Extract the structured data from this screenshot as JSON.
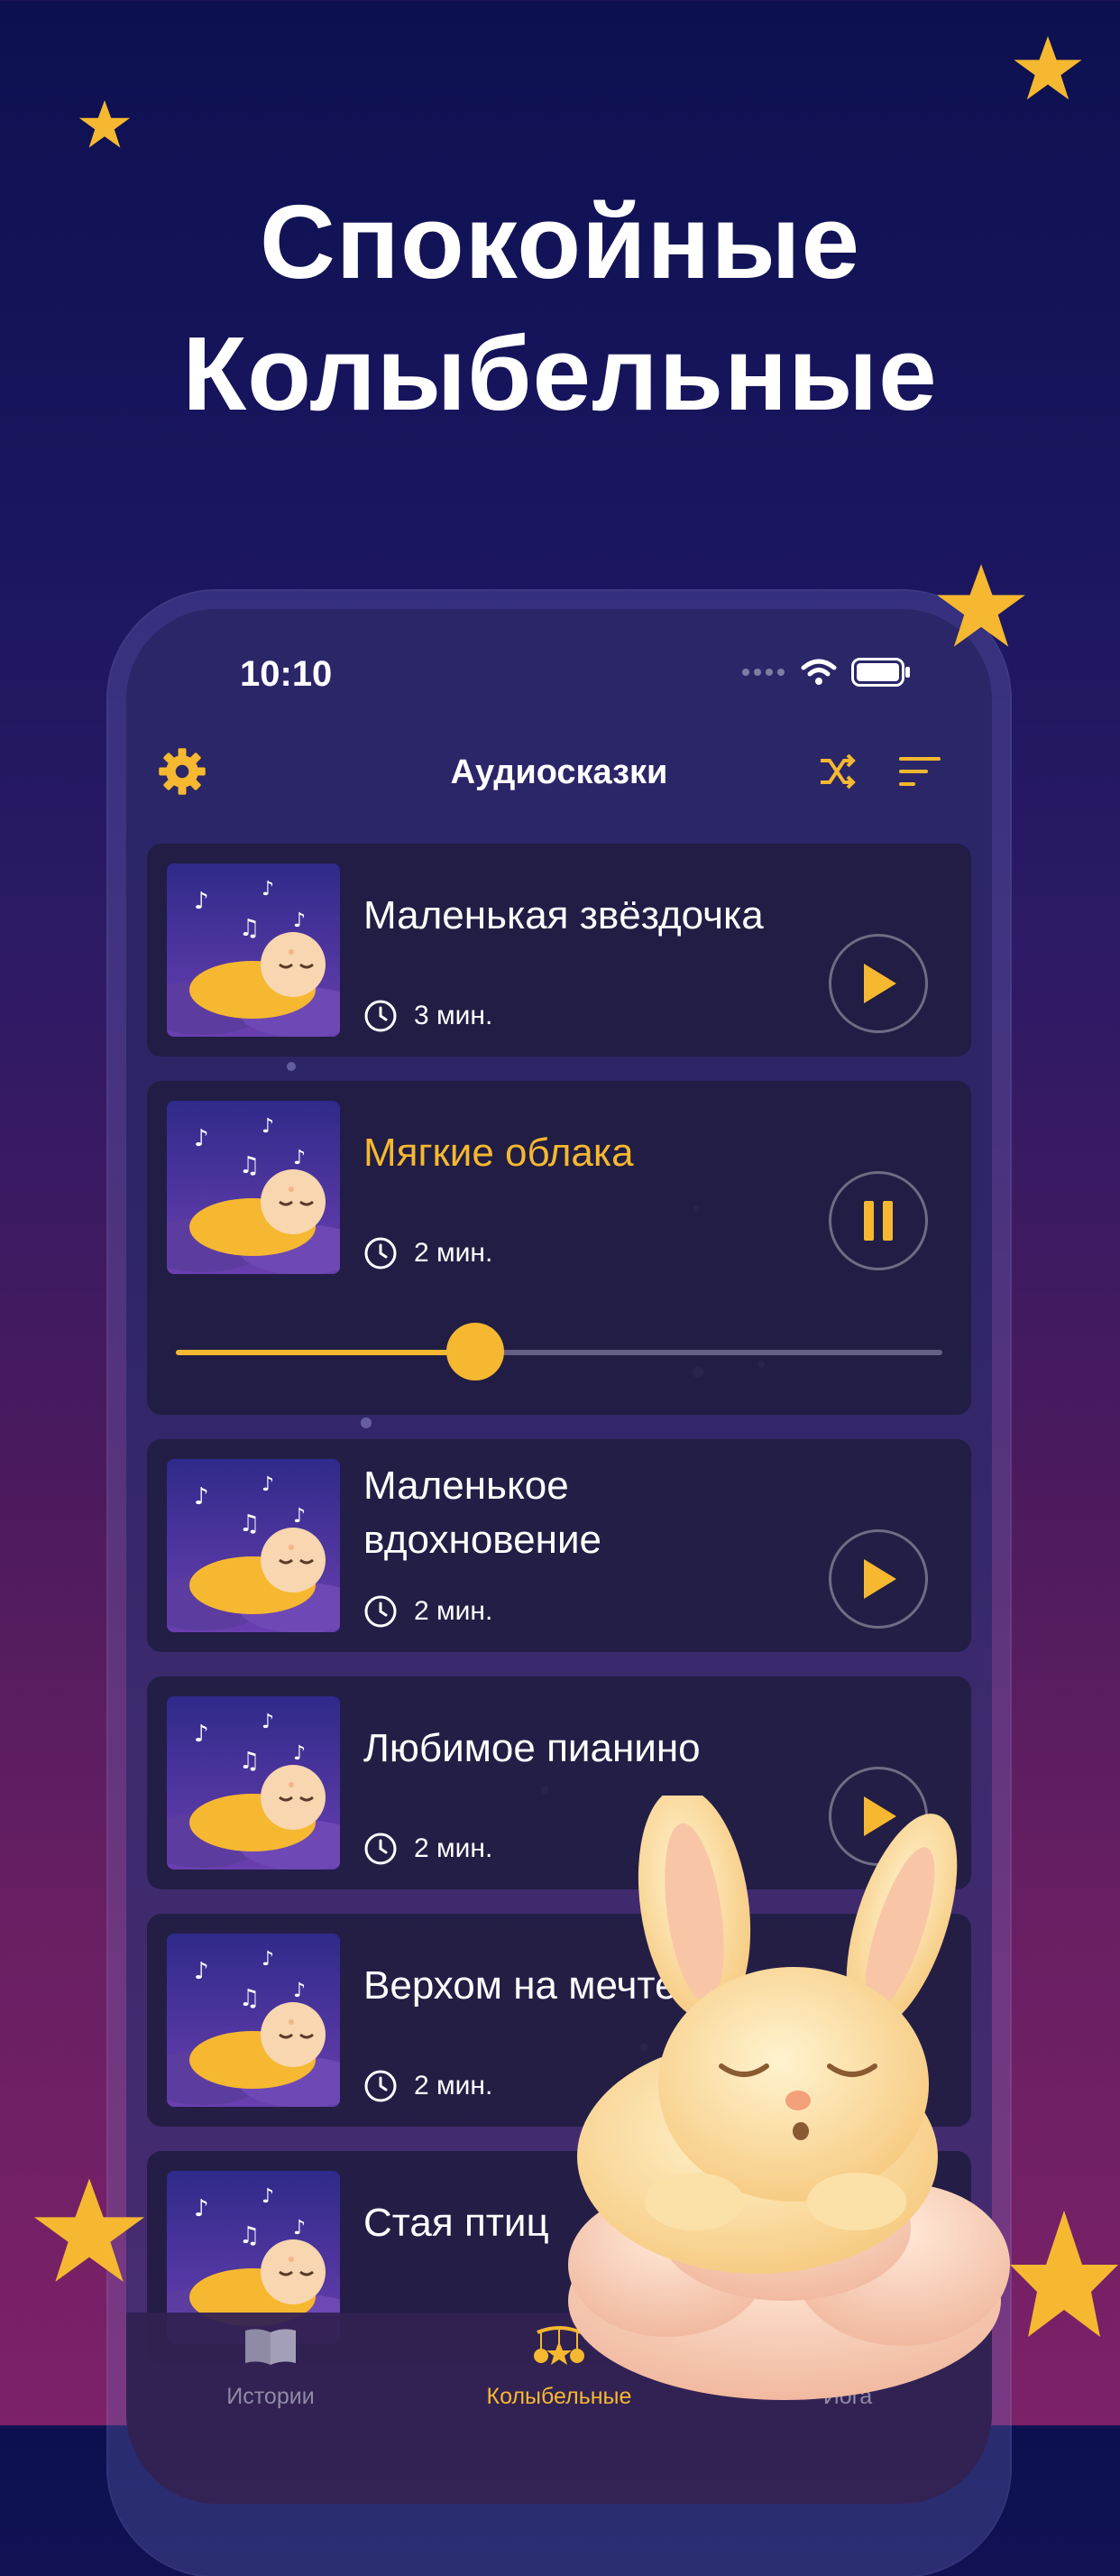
{
  "headline": {
    "line1": "Спокойные",
    "line2": "Колыбельные"
  },
  "colors": {
    "accent": "#f5b830",
    "background_top": "#0c1050",
    "background_bottom": "#7c2168"
  },
  "status_bar": {
    "time": "10:10"
  },
  "nav": {
    "title": "Аудиосказки",
    "left_icon": "gear-icon",
    "right_icons": [
      "shuffle-icon",
      "sort-icon"
    ]
  },
  "tracks": [
    {
      "title": "Маленькая звёздочка",
      "duration": "3 мин.",
      "state": "play"
    },
    {
      "title": "Мягкие облака",
      "duration": "2 мин.",
      "state": "pause",
      "progress": 0.39
    },
    {
      "title": "Маленькое вдохновение",
      "duration": "2 мин.",
      "state": "play"
    },
    {
      "title": "Любимое пианино",
      "duration": "2 мин.",
      "state": "play"
    },
    {
      "title": "Верхом на мечте",
      "duration": "2 мин.",
      "state": "none"
    },
    {
      "title": "Стая птиц",
      "duration": "",
      "state": "none"
    }
  ],
  "tabs": [
    {
      "label": "Истории",
      "icon": "book-icon",
      "active": false
    },
    {
      "label": "Колыбельные",
      "icon": "crib-mobile-icon",
      "active": true
    },
    {
      "label": "Йога",
      "icon": "yoga-icon",
      "active": false
    }
  ]
}
